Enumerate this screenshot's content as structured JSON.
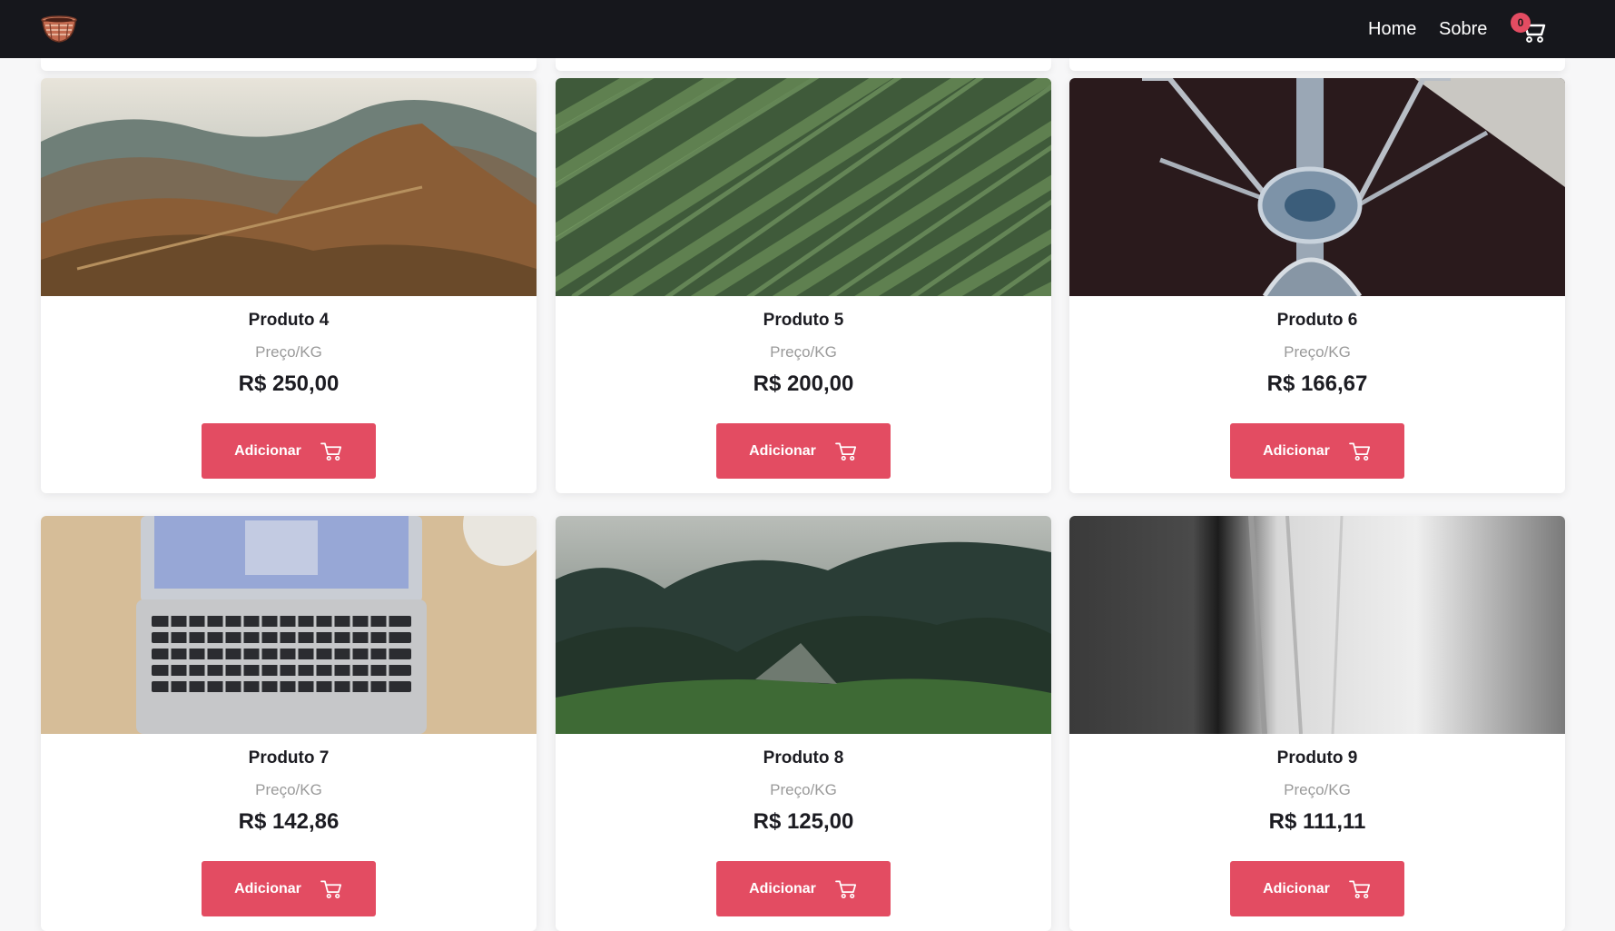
{
  "navbar": {
    "logo": "basket-icon",
    "links": [
      {
        "label": "Home"
      },
      {
        "label": "Sobre"
      }
    ],
    "cart": {
      "count": "0",
      "icon": "cart-icon"
    }
  },
  "colors": {
    "navbar_bg": "#16171c",
    "accent": "#e34c62",
    "page_bg": "#f7f7f8"
  },
  "products": [
    {
      "title": "Produto 4",
      "unit": "Preço/KG",
      "price": "R$ 250,00",
      "button": "Adicionar",
      "image": "mountain-landscape"
    },
    {
      "title": "Produto 5",
      "unit": "Preço/KG",
      "price": "R$ 200,00",
      "button": "Adicionar",
      "image": "green-field-rows"
    },
    {
      "title": "Produto 6",
      "unit": "Preço/KG",
      "price": "R$ 166,67",
      "button": "Adicionar",
      "image": "metal-machine"
    },
    {
      "title": "Produto 7",
      "unit": "Preço/KG",
      "price": "R$ 142,86",
      "button": "Adicionar",
      "image": "laptop-desk"
    },
    {
      "title": "Produto 8",
      "unit": "Preço/KG",
      "price": "R$ 125,00",
      "button": "Adicionar",
      "image": "foggy-forest"
    },
    {
      "title": "Produto 9",
      "unit": "Preço/KG",
      "price": "R$ 111,11",
      "button": "Adicionar",
      "image": "waterfall-bw"
    }
  ]
}
